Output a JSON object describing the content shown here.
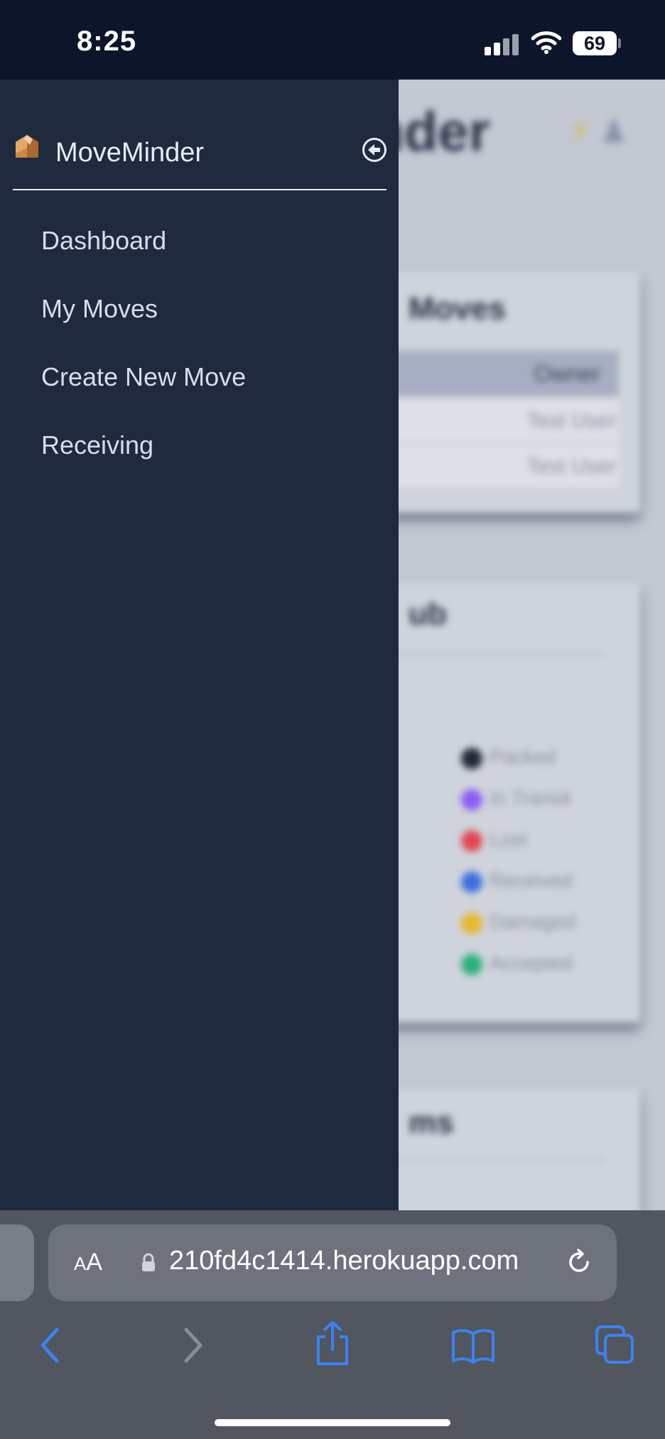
{
  "status_bar": {
    "time": "8:25",
    "battery": "69"
  },
  "background_page": {
    "title_fragment": "nder",
    "card1_title": "Moves",
    "card1_header": "Owner",
    "card1_rows": [
      "Test User",
      "Test User"
    ],
    "card2_title": "ub",
    "card2_legend": [
      "Packed",
      "In Transit",
      "Lost",
      "Received",
      "Damaged",
      "Accepted"
    ],
    "card3_title": "ms"
  },
  "sidebar": {
    "brand": "MoveMinder",
    "items": [
      {
        "label": "Dashboard"
      },
      {
        "label": "My Moves"
      },
      {
        "label": "Create New Move"
      },
      {
        "label": "Receiving"
      }
    ]
  },
  "browser": {
    "text_size_label": "AA",
    "url": "210fd4c1414.herokuapp.com"
  },
  "colors": {
    "sidebar_bg": "#1f2a3e",
    "status_bar_bg": "#0d152b",
    "toolbar_bg": "#52565e",
    "accent_blue": "#3b82f6"
  },
  "icons": [
    "box-logo-icon",
    "collapse-arrow-icon",
    "lock-icon",
    "reload-icon",
    "back-icon",
    "forward-icon",
    "share-icon",
    "bookmarks-icon",
    "tabs-icon",
    "signal-icon",
    "wifi-icon",
    "battery-icon"
  ]
}
